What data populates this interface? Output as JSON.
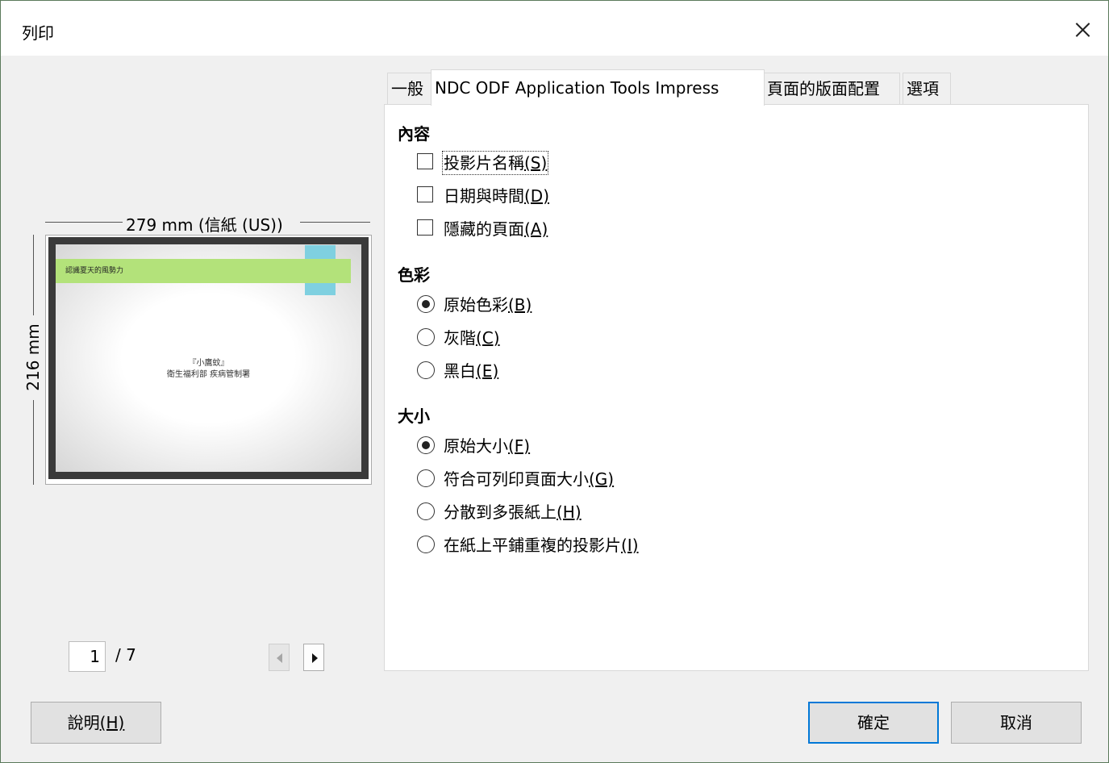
{
  "window": {
    "title": "列印"
  },
  "tabs": [
    {
      "label": "一般"
    },
    {
      "label": "NDC ODF Application Tools Impress"
    },
    {
      "label": "頁面的版面配置"
    },
    {
      "label": "選項"
    }
  ],
  "content": {
    "title": "內容",
    "items": [
      {
        "label": "投影片名稱",
        "mnemonic": "(S)",
        "checked": false
      },
      {
        "label": "日期與時間",
        "mnemonic": "(D)",
        "checked": false
      },
      {
        "label": "隱藏的頁面",
        "mnemonic": "(A)",
        "checked": false
      }
    ]
  },
  "color": {
    "title": "色彩",
    "items": [
      {
        "label": "原始色彩",
        "mnemonic": "(B)",
        "selected": true
      },
      {
        "label": "灰階",
        "mnemonic": "(C)",
        "selected": false
      },
      {
        "label": "黑白",
        "mnemonic": "(E)",
        "selected": false
      }
    ]
  },
  "size": {
    "title": "大小",
    "items": [
      {
        "label": "原始大小",
        "mnemonic": "(F)",
        "selected": true
      },
      {
        "label": "符合可列印頁面大小",
        "mnemonic": "(G)",
        "selected": false
      },
      {
        "label": "分散到多張紙上",
        "mnemonic": "(H)",
        "selected": false
      },
      {
        "label": "在紙上平鋪重複的投影片",
        "mnemonic": "(I)",
        "selected": false
      }
    ]
  },
  "preview": {
    "width_label": "279 mm (信紙 (US))",
    "height_label": "216 mm",
    "slide_title": "認識夏天的風勢力",
    "slide_line1": "『小鷹蚊』",
    "slide_line2": "衛生福利部 疾病管制署"
  },
  "pager": {
    "current": "1",
    "total": "/ 7"
  },
  "buttons": {
    "help": "說明",
    "help_mnemonic": "(H)",
    "ok": "確定",
    "cancel": "取消"
  }
}
